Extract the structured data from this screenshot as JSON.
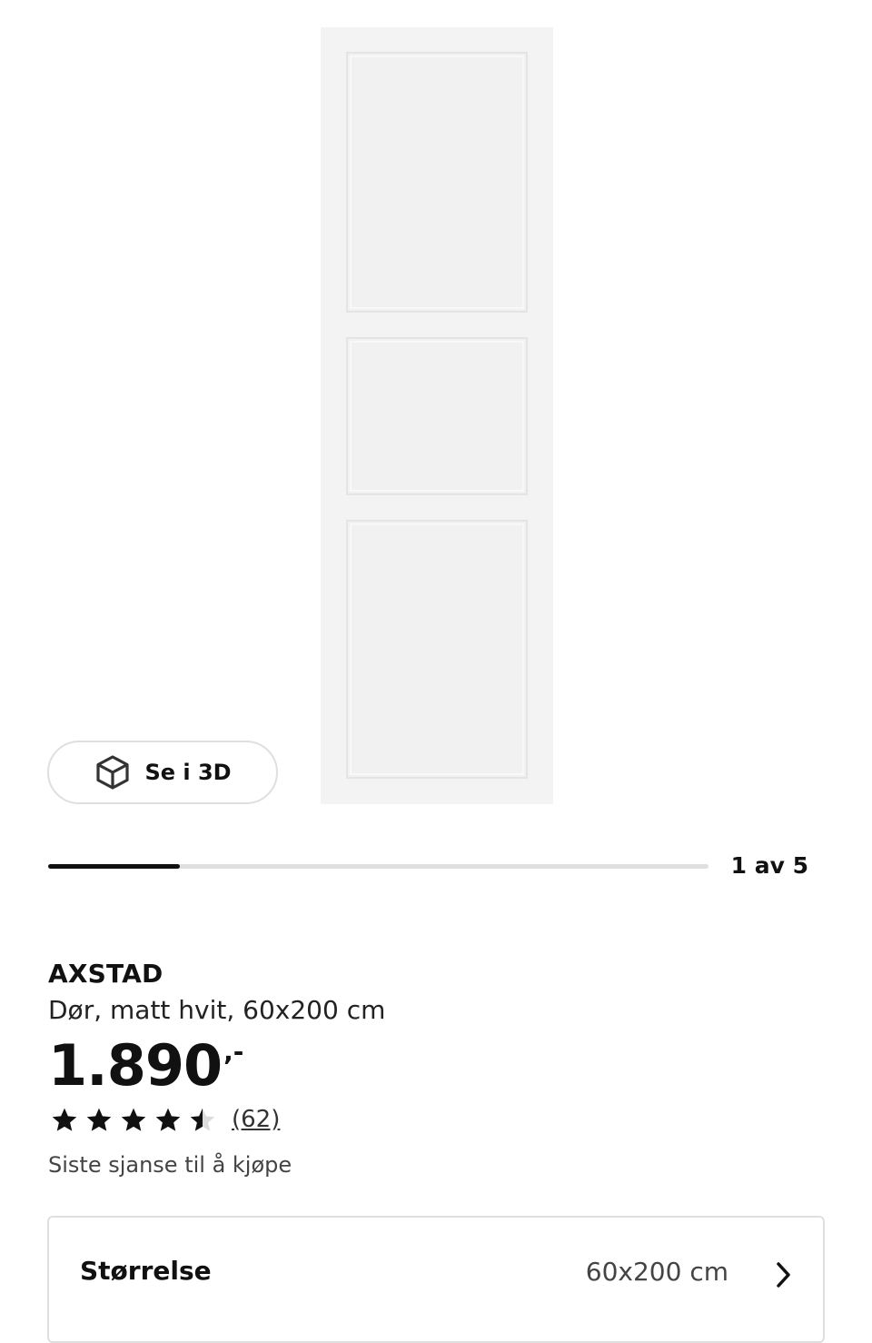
{
  "gallery": {
    "view_3d_label": "Se i 3D",
    "current_image": 1,
    "total_images": 5,
    "counter_text": "1 av 5",
    "progress_fraction": 0.2
  },
  "product": {
    "name": "AXSTAD",
    "description": "Dør, matt hvit, 60x200 cm",
    "price_integer": "1.890",
    "price_suffix": ",-",
    "rating_value": 4.5,
    "rating_max": 5,
    "review_count_text": "(62)",
    "availability": "Siste sjanse til å kjøpe"
  },
  "size_selector": {
    "label": "Størrelse",
    "value": "60x200 cm"
  },
  "icons": {
    "view_3d": "cube-icon",
    "star": "star-icon",
    "chevron": "chevron-right-icon"
  },
  "colors": {
    "text": "#111111",
    "muted": "#444444",
    "border": "#dfdfdf",
    "door": "#f3f3f3"
  }
}
